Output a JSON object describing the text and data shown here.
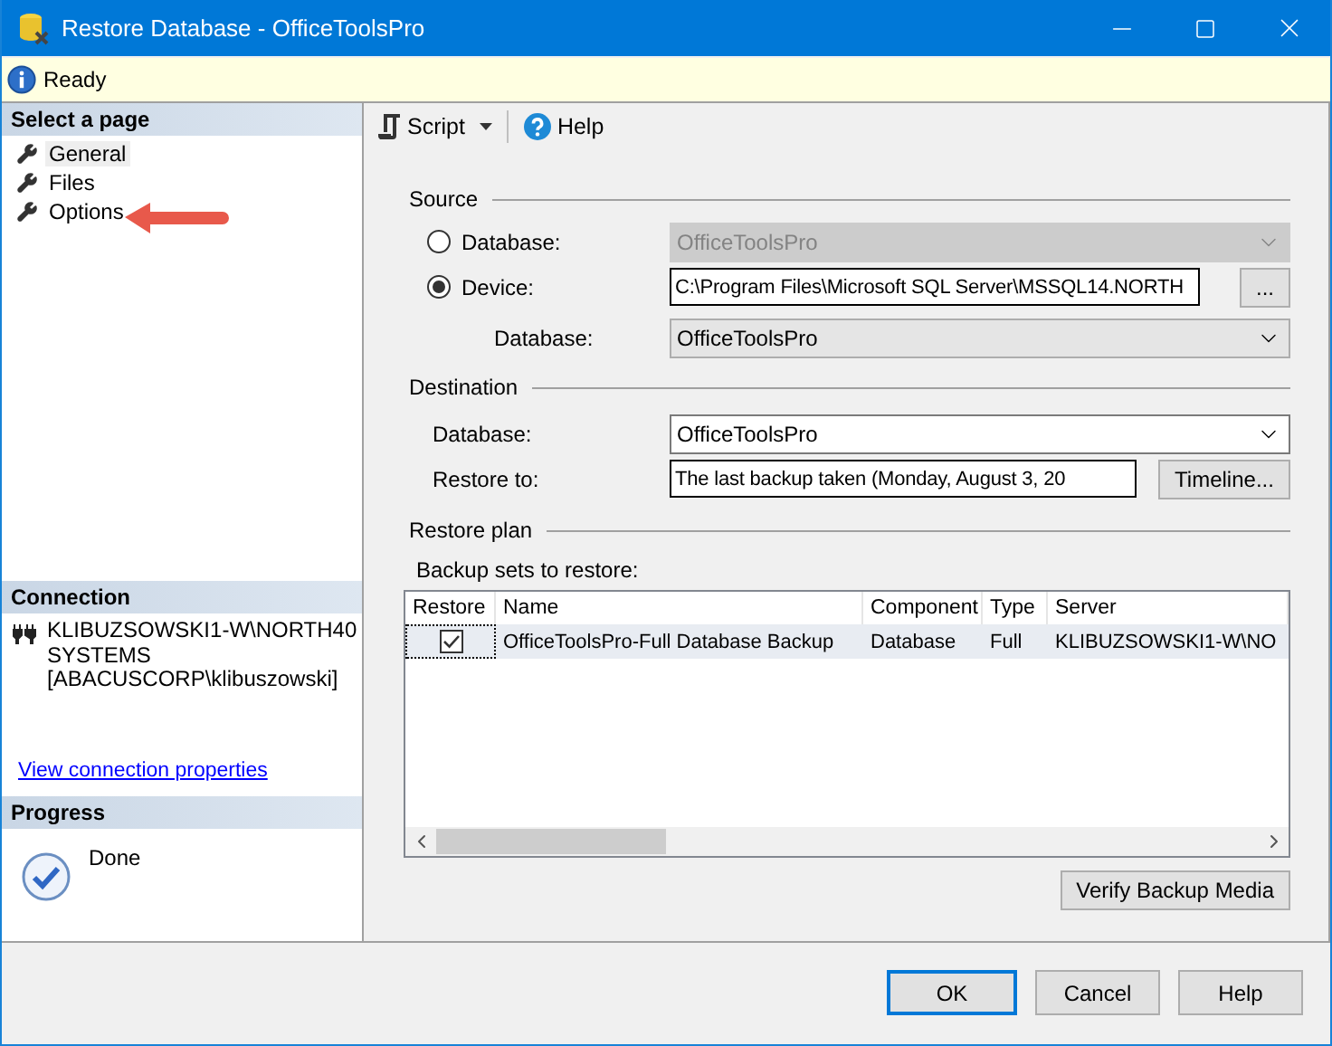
{
  "window": {
    "title": "Restore Database - OfficeToolsPro"
  },
  "status": {
    "text": "Ready"
  },
  "sidebar": {
    "header": "Select a page",
    "pages": [
      {
        "label": "General",
        "selected": true
      },
      {
        "label": "Files",
        "selected": false
      },
      {
        "label": "Options",
        "selected": false
      }
    ],
    "connection": {
      "header": "Connection",
      "lines": [
        "KLIBUZSOWSKI1-W\\NORTH40",
        "SYSTEMS",
        "[ABACUSCORP\\klibuszowski]"
      ],
      "link": "View connection properties"
    },
    "progress": {
      "header": "Progress",
      "text": "Done"
    }
  },
  "toolbar": [
    {
      "kind": "script",
      "label": "Script"
    },
    {
      "kind": "help",
      "label": "Help"
    }
  ],
  "source": {
    "title": "Source",
    "options": [
      {
        "label": "Database:",
        "selected": false,
        "value": "OfficeToolsPro",
        "kind": "combo",
        "disabled": true
      },
      {
        "label": "Device:",
        "selected": true,
        "value": "C:\\Program Files\\Microsoft SQL Server\\MSSQL14.NORTH",
        "kind": "path",
        "browse": "..."
      }
    ],
    "database": {
      "label": "Database:",
      "value": "OfficeToolsPro",
      "editable": false
    }
  },
  "destination": {
    "title": "Destination",
    "database": {
      "label": "Database:",
      "value": "OfficeToolsPro",
      "editable": true
    },
    "restore_to": {
      "label": "Restore to:",
      "value": "The last backup taken (Monday, August 3, 20",
      "button": "Timeline..."
    }
  },
  "restore_plan": {
    "title": "Restore plan",
    "grid_label": "Backup sets to restore:",
    "columns": [
      "Restore",
      "Name",
      "Component",
      "Type",
      "Server"
    ],
    "rows": [
      {
        "checked": true,
        "selected": true,
        "name": "OfficeToolsPro-Full Database Backup",
        "component": "Database",
        "type": "Full",
        "server": "KLIBUZSOWSKI1-W\\NO"
      }
    ],
    "verify_button": "Verify Backup Media"
  },
  "buttons": [
    {
      "label": "OK",
      "default": true
    },
    {
      "label": "Cancel",
      "default": false
    },
    {
      "label": "Help",
      "default": false
    }
  ]
}
